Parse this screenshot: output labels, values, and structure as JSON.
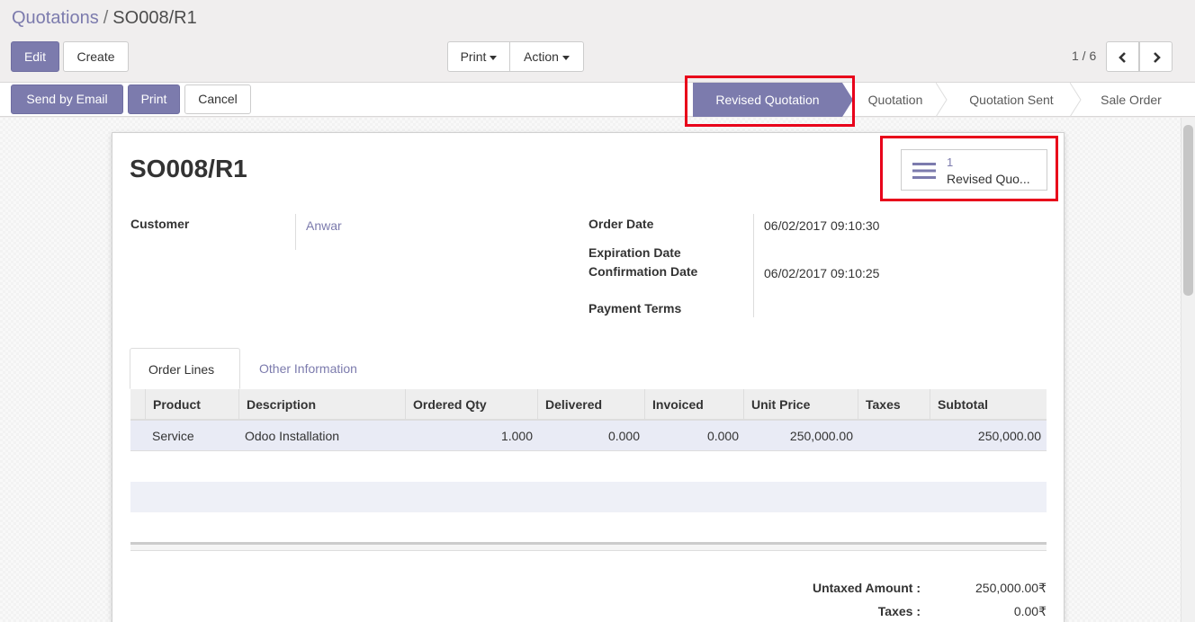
{
  "breadcrumb": {
    "parent": "Quotations",
    "separator": "/",
    "current": "SO008/R1"
  },
  "buttons": {
    "edit": "Edit",
    "create": "Create",
    "print_menu": "Print",
    "action_menu": "Action"
  },
  "pager": {
    "value": "1 / 6"
  },
  "statusbar": {
    "send_by_email": "Send by Email",
    "print": "Print",
    "cancel": "Cancel",
    "stages": [
      "Revised Quotation",
      "Quotation",
      "Quotation Sent",
      "Sale Order"
    ],
    "active_stage": "Revised Quotation"
  },
  "record": {
    "title": "SO008/R1",
    "smart_button": {
      "count": "1",
      "label": "Revised Quo..."
    },
    "customer_label": "Customer",
    "customer": "Anwar",
    "order_date_label": "Order Date",
    "order_date": "06/02/2017 09:10:30",
    "expiration_date_label": "Expiration Date",
    "confirmation_date_label": "Confirmation Date",
    "confirmation_date": "06/02/2017 09:10:25",
    "payment_terms_label": "Payment Terms"
  },
  "tabs": [
    "Order Lines",
    "Other Information"
  ],
  "order_lines": {
    "columns": [
      "Product",
      "Description",
      "Ordered Qty",
      "Delivered",
      "Invoiced",
      "Unit Price",
      "Taxes",
      "Subtotal"
    ],
    "rows": [
      {
        "product": "Service",
        "description": "Odoo Installation",
        "ordered_qty": "1.000",
        "delivered": "0.000",
        "invoiced": "0.000",
        "unit_price": "250,000.00",
        "taxes": "",
        "subtotal": "250,000.00"
      }
    ]
  },
  "totals": {
    "untaxed_label": "Untaxed Amount :",
    "untaxed_value": "250,000.00₹",
    "taxes_label": "Taxes :",
    "taxes_value": "0.00₹"
  },
  "colors": {
    "primary": "#7c7bad",
    "highlight": "#e8001a"
  }
}
